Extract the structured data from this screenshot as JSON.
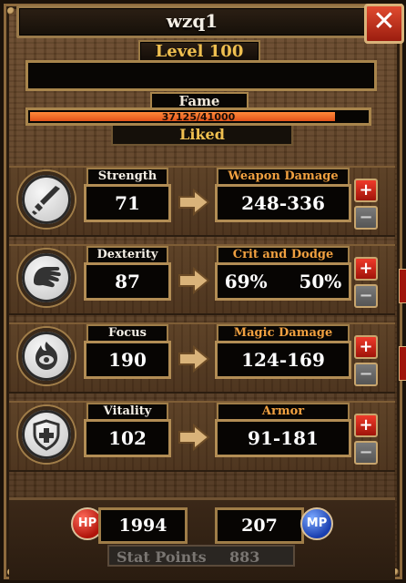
{
  "window": {
    "title": "wzq1",
    "close_label": "✕"
  },
  "level": "Level 100",
  "name": "",
  "fame": {
    "label": "Fame",
    "current": 37125,
    "max": 41000,
    "text": "37125/41000",
    "status": "Liked",
    "progress": 0.9055
  },
  "stats": [
    {
      "label": "Strength",
      "value": "71",
      "derived_label": "Weapon Damage",
      "derived_value": "248-336",
      "icon": "sword-icon"
    },
    {
      "label": "Dexterity",
      "value": "87",
      "derived_label": "Crit and Dodge",
      "derived_value": "69%     50%",
      "icon": "fist-icon"
    },
    {
      "label": "Focus",
      "value": "190",
      "derived_label": "Magic Damage",
      "derived_value": "124-169",
      "icon": "flame-eye-icon"
    },
    {
      "label": "Vitality",
      "value": "102",
      "derived_label": "Armor",
      "derived_value": "91-181",
      "icon": "shield-cross-icon"
    }
  ],
  "buttons": {
    "plus": "+",
    "minus": "−"
  },
  "hp": {
    "label": "HP",
    "value": "1994"
  },
  "mp": {
    "label": "MP",
    "value": "207"
  },
  "stat_points": {
    "label": "Stat Points",
    "value": "883"
  },
  "colors": {
    "accent_gold": "#f0c050",
    "fame_fill": "#ff7a2a",
    "hp": "#c0140a",
    "mp": "#1a3fb0"
  }
}
